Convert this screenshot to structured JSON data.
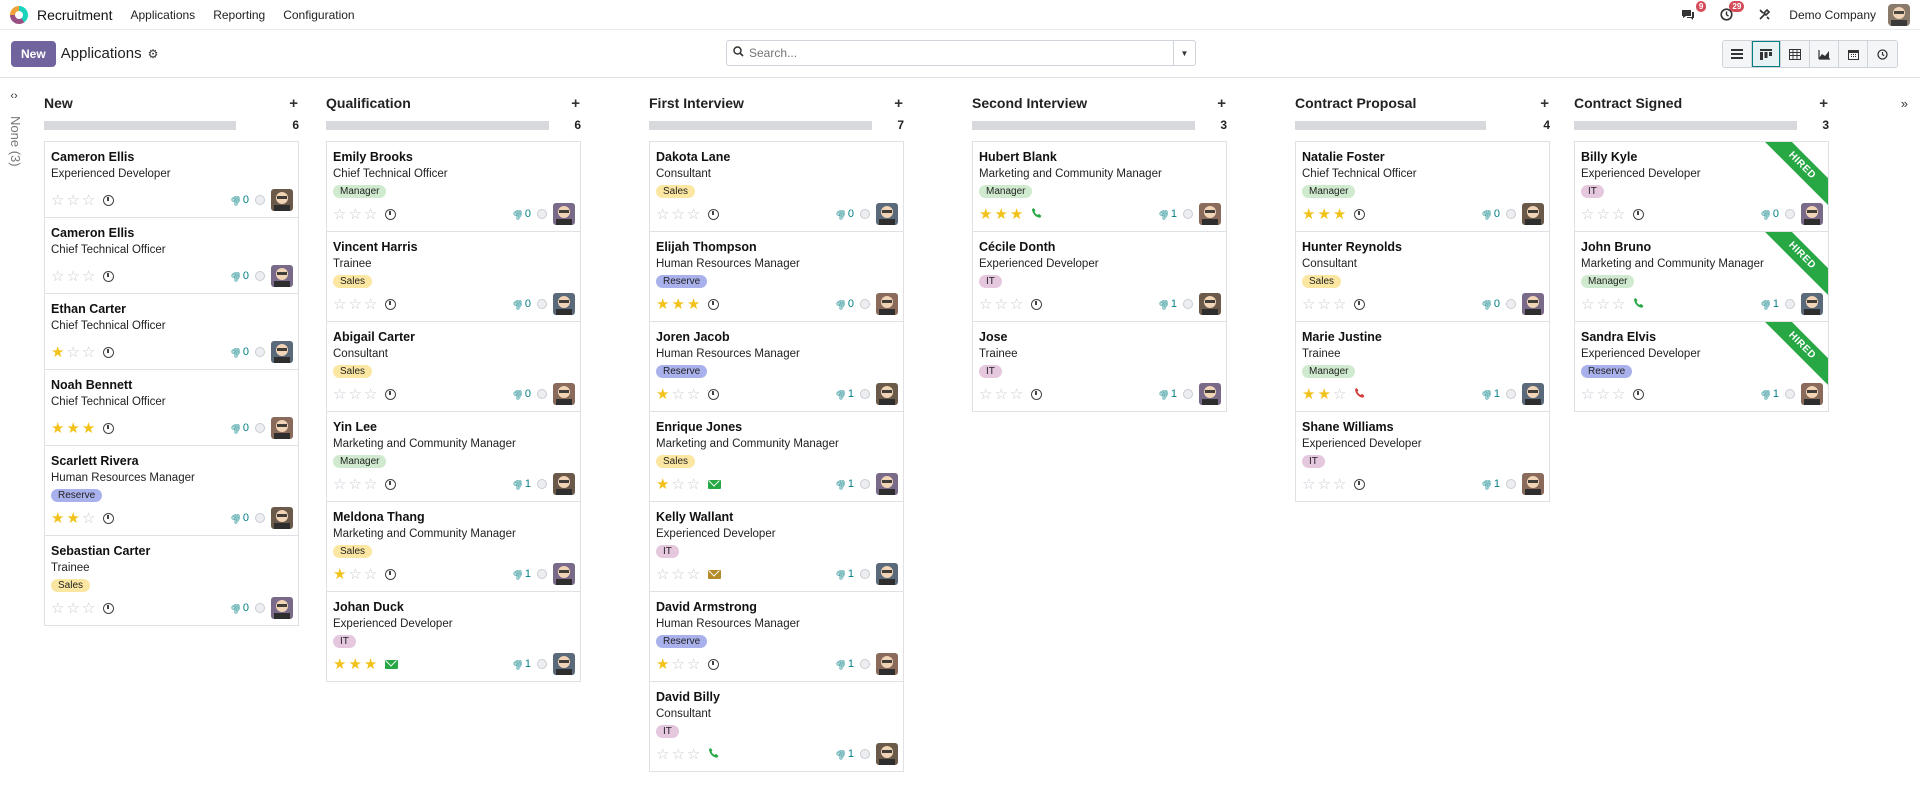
{
  "navbar": {
    "app_name": "Recruitment",
    "menu": [
      "Applications",
      "Reporting",
      "Configuration"
    ],
    "messages_count": "9",
    "activities_count": "29",
    "company": "Demo Company"
  },
  "control": {
    "new_label": "New",
    "breadcrumb": "Applications",
    "search_placeholder": "Search..."
  },
  "views": [
    "list-icon",
    "kanban-icon",
    "pivot-icon",
    "graph-icon",
    "calendar-icon",
    "activity-icon"
  ],
  "folded_column": "None (3)",
  "colors": {
    "accent": "#71639e",
    "teal": "#017e84",
    "star": "#f2c21a",
    "hired": "#28a745"
  },
  "columns": [
    {
      "title": "New",
      "count": "6",
      "cards": [
        {
          "name": "Cameron Ellis",
          "job": "Experienced Developer",
          "tag": "",
          "stars": 0,
          "activity": "clock",
          "attachments": "0"
        },
        {
          "name": "Cameron Ellis",
          "job": "Chief Technical Officer",
          "tag": "",
          "stars": 0,
          "activity": "clock",
          "attachments": "0"
        },
        {
          "name": "Ethan Carter",
          "job": "Chief Technical Officer",
          "tag": "",
          "stars": 1,
          "activity": "clock",
          "attachments": "0"
        },
        {
          "name": "Noah Bennett",
          "job": "Chief Technical Officer",
          "tag": "",
          "stars": 3,
          "activity": "clock",
          "attachments": "0"
        },
        {
          "name": "Scarlett Rivera",
          "job": "Human Resources Manager",
          "tag": "Reserve",
          "stars": 2,
          "activity": "clock",
          "attachments": "0"
        },
        {
          "name": "Sebastian Carter",
          "job": "Trainee",
          "tag": "Sales",
          "stars": 0,
          "activity": "clock",
          "attachments": "0"
        }
      ]
    },
    {
      "title": "Qualification",
      "count": "6",
      "cards": [
        {
          "name": "Emily Brooks",
          "job": "Chief Technical Officer",
          "tag": "Manager",
          "stars": 0,
          "activity": "clock",
          "attachments": "0"
        },
        {
          "name": "Vincent Harris",
          "job": "Trainee",
          "tag": "Sales",
          "stars": 0,
          "activity": "clock",
          "attachments": "0"
        },
        {
          "name": "Abigail Carter",
          "job": "Consultant",
          "tag": "Sales",
          "stars": 0,
          "activity": "clock",
          "attachments": "0"
        },
        {
          "name": "Yin Lee",
          "job": "Marketing and Community Manager",
          "tag": "Manager",
          "stars": 0,
          "activity": "clock",
          "attachments": "1"
        },
        {
          "name": "Meldona Thang",
          "job": "Marketing and Community Manager",
          "tag": "Sales",
          "stars": 1,
          "activity": "clock",
          "attachments": "1"
        },
        {
          "name": "Johan Duck",
          "job": "Experienced Developer",
          "tag": "IT",
          "stars": 3,
          "activity": "mail-green",
          "attachments": "1"
        }
      ]
    },
    {
      "title": "First Interview",
      "count": "7",
      "cards": [
        {
          "name": "Dakota Lane",
          "job": "Consultant",
          "tag": "Sales",
          "stars": 0,
          "activity": "clock",
          "attachments": "0"
        },
        {
          "name": "Elijah Thompson",
          "job": "Human Resources Manager",
          "tag": "Reserve",
          "stars": 3,
          "activity": "clock",
          "attachments": "0"
        },
        {
          "name": "Joren Jacob",
          "job": "Human Resources Manager",
          "tag": "Reserve",
          "stars": 1,
          "activity": "clock",
          "attachments": "1"
        },
        {
          "name": "Enrique Jones",
          "job": "Marketing and Community Manager",
          "tag": "Sales",
          "stars": 1,
          "activity": "mail-green",
          "attachments": "1"
        },
        {
          "name": "Kelly Wallant",
          "job": "Experienced Developer",
          "tag": "IT",
          "stars": 0,
          "activity": "mail-brown",
          "attachments": "1"
        },
        {
          "name": "David Armstrong",
          "job": "Human Resources Manager",
          "tag": "Reserve",
          "stars": 1,
          "activity": "clock",
          "attachments": "1"
        },
        {
          "name": "David Billy",
          "job": "Consultant",
          "tag": "IT",
          "stars": 0,
          "activity": "phone-green",
          "attachments": "1"
        }
      ]
    },
    {
      "title": "Second Interview",
      "count": "3",
      "cards": [
        {
          "name": "Hubert Blank",
          "job": "Marketing and Community Manager",
          "tag": "Manager",
          "stars": 3,
          "activity": "phone-green",
          "attachments": "1"
        },
        {
          "name": "Cécile Donth",
          "job": "Experienced Developer",
          "tag": "IT",
          "stars": 0,
          "activity": "clock",
          "attachments": "1"
        },
        {
          "name": "Jose",
          "job": "Trainee",
          "tag": "IT",
          "stars": 0,
          "activity": "clock",
          "attachments": "1"
        }
      ]
    },
    {
      "title": "Contract Proposal",
      "count": "4",
      "cards": [
        {
          "name": "Natalie Foster",
          "job": "Chief Technical Officer",
          "tag": "Manager",
          "stars": 3,
          "activity": "clock",
          "attachments": "0"
        },
        {
          "name": "Hunter Reynolds",
          "job": "Consultant",
          "tag": "Sales",
          "stars": 0,
          "activity": "clock",
          "attachments": "0"
        },
        {
          "name": "Marie Justine",
          "job": "Trainee",
          "tag": "Manager",
          "stars": 2,
          "activity": "phone-red",
          "attachments": "1"
        },
        {
          "name": "Shane Williams",
          "job": "Experienced Developer",
          "tag": "IT",
          "stars": 0,
          "activity": "clock",
          "attachments": "1"
        }
      ]
    },
    {
      "title": "Contract Signed",
      "count": "3",
      "cards": [
        {
          "name": "Billy Kyle",
          "job": "Experienced Developer",
          "tag": "IT",
          "stars": 0,
          "activity": "clock",
          "attachments": "0",
          "ribbon": "HIRED"
        },
        {
          "name": "John Bruno",
          "job": "Marketing and Community Manager",
          "tag": "Manager",
          "stars": 0,
          "activity": "phone-green",
          "attachments": "1",
          "ribbon": "HIRED"
        },
        {
          "name": "Sandra Elvis",
          "job": "Experienced Developer",
          "tag": "Reserve",
          "stars": 0,
          "activity": "clock",
          "attachments": "1",
          "ribbon": "HIRED"
        }
      ]
    }
  ]
}
